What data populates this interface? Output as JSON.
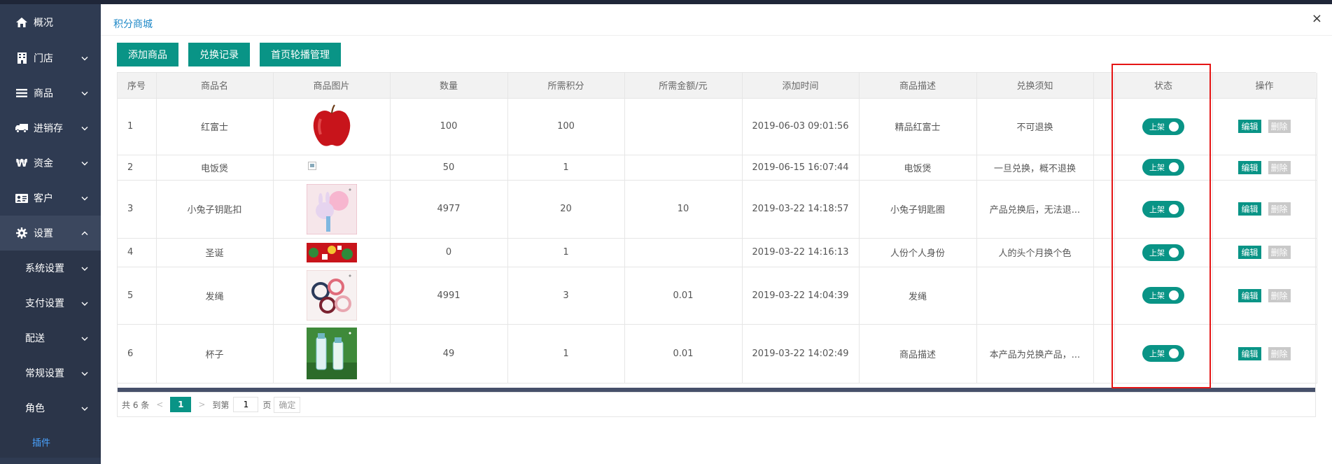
{
  "sidebar": {
    "items": [
      {
        "label": "概况",
        "icon": "home-icon"
      },
      {
        "label": "门店",
        "icon": "building-icon"
      },
      {
        "label": "商品",
        "icon": "list-icon"
      },
      {
        "label": "进销存",
        "icon": "truck-icon"
      },
      {
        "label": "资金",
        "icon": "won-icon"
      },
      {
        "label": "客户",
        "icon": "id-card-icon"
      },
      {
        "label": "设置",
        "icon": "gear-icon"
      }
    ],
    "sub_items": [
      "系统设置",
      "支付设置",
      "配送",
      "常规设置",
      "角色"
    ],
    "plugin": "插件"
  },
  "panel": {
    "title": "积分商城",
    "close": "×"
  },
  "toolbar": {
    "add": "添加商品",
    "records": "兑换记录",
    "banner": "首页轮播管理"
  },
  "table": {
    "headers": [
      "序号",
      "商品名",
      "商品图片",
      "数量",
      "所需积分",
      "所需金额/元",
      "添加时间",
      "商品描述",
      "兑换须知",
      "",
      "状态",
      "操作"
    ],
    "rows": [
      {
        "no": "1",
        "name": "红富士",
        "img": "apple",
        "qty": "100",
        "points": "100",
        "amount": "",
        "time": "2019-06-03 09:01:56",
        "desc": "精品红富士",
        "notice": "不可退换",
        "status": "上架"
      },
      {
        "no": "2",
        "name": "电饭煲",
        "img": "broken",
        "qty": "50",
        "points": "1",
        "amount": "",
        "time": "2019-06-15 16:07:44",
        "desc": "电饭煲",
        "notice": "一旦兑换，概不退换",
        "status": "上架"
      },
      {
        "no": "3",
        "name": "小兔子钥匙扣",
        "img": "bunny",
        "qty": "4977",
        "points": "20",
        "amount": "10",
        "time": "2019-03-22 14:18:57",
        "desc": "小兔子钥匙圈",
        "notice": "产品兑换后，无法退...",
        "status": "上架"
      },
      {
        "no": "4",
        "name": "圣诞",
        "img": "xmas",
        "qty": "0",
        "points": "1",
        "amount": "",
        "time": "2019-03-22 14:16:13",
        "desc": "人份个人身份",
        "notice": "人的头个月换个色",
        "status": "上架"
      },
      {
        "no": "5",
        "name": "发绳",
        "img": "hairband",
        "qty": "4991",
        "points": "3",
        "amount": "0.01",
        "time": "2019-03-22 14:04:39",
        "desc": "发绳",
        "notice": "",
        "status": "上架"
      },
      {
        "no": "6",
        "name": "杯子",
        "img": "cup",
        "qty": "49",
        "points": "1",
        "amount": "0.01",
        "time": "2019-03-22 14:02:49",
        "desc": "商品描述",
        "notice": "本产品为兑换产品，...",
        "status": "上架"
      }
    ],
    "edit_label": "编辑",
    "delete_label": "删除"
  },
  "pager": {
    "total": "共 6 条",
    "prev": "<",
    "current": "1",
    "next": ">",
    "goto": "到第",
    "page_value": "1",
    "page_unit": "页",
    "confirm": "确定"
  },
  "colors": {
    "sidebar_bg": "#2f3b52",
    "accent": "#099486",
    "title_blue": "#1e88c7",
    "highlight_red": "#e51515"
  }
}
